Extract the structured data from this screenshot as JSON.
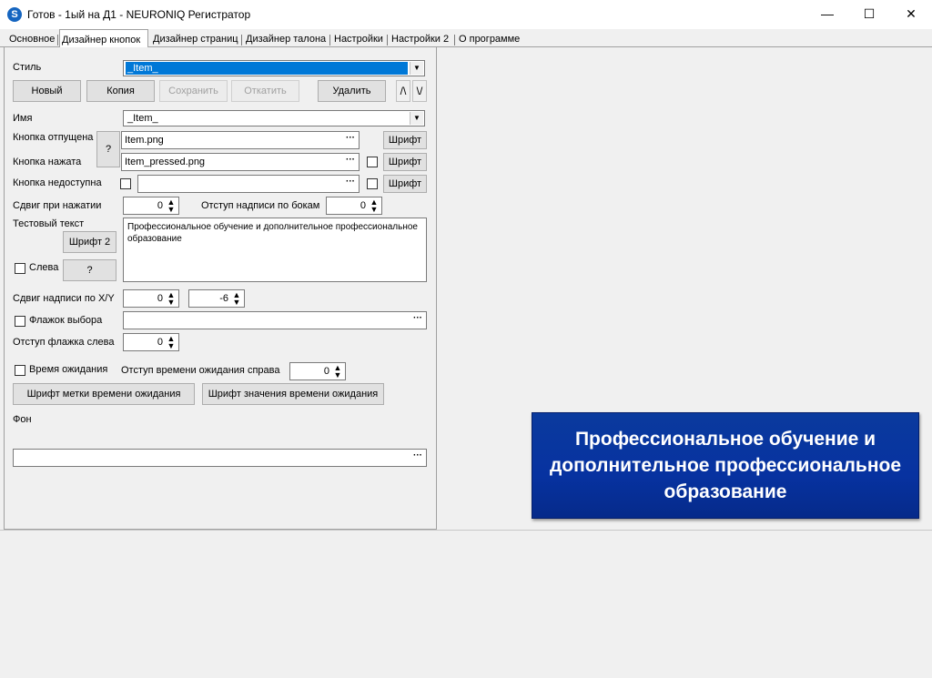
{
  "window": {
    "app_icon": "S",
    "title": "Готов - 1ый на Д1 - NEURONIQ Регистратор",
    "minimize": "—",
    "maximize": "☐",
    "close": "✕"
  },
  "tabs": [
    {
      "label": "Основное",
      "active": false
    },
    {
      "label": "Дизайнер кнопок",
      "active": true
    },
    {
      "label": "Дизайнер страниц",
      "active": false
    },
    {
      "label": "Дизайнер талона",
      "active": false
    },
    {
      "label": "Настройки",
      "active": false
    },
    {
      "label": "Настройки 2",
      "active": false
    },
    {
      "label": "О программе",
      "active": false
    }
  ],
  "style_row": {
    "label": "Стиль",
    "value": "_Item_"
  },
  "style_buttons": {
    "new": "Новый",
    "copy": "Копия",
    "save": "Сохранить",
    "revert": "Откатить",
    "delete": "Удалить",
    "up": "/\\",
    "down": "\\/"
  },
  "name_row": {
    "label": "Имя",
    "value": "_Item_"
  },
  "button_states": {
    "help_label": "?",
    "released_label": "Кнопка отпущена",
    "released_value": "Item.png",
    "pressed_label": "Кнопка нажата",
    "pressed_value": "Item_pressed.png",
    "disabled_label": "Кнопка недоступна",
    "disabled_value": "",
    "browse": "···",
    "font_label": "Шрифт"
  },
  "offsets": {
    "press_shift_label": "Сдвиг при нажатии",
    "press_shift_value": "0",
    "side_padding_label": "Отступ надписи по бокам",
    "side_padding_value": "0"
  },
  "test_text": {
    "label": "Тестовый текст",
    "font2": "Шрифт 2",
    "left_label": "Слева",
    "help": "?",
    "value": "Профессиональное обучение и дополнительное профессиональное образование"
  },
  "caption_shift": {
    "label": "Сдвиг надписи по X/Y",
    "x": "0",
    "y": "-6"
  },
  "checkbox_flag": {
    "label": "Флажок выбора",
    "value": ""
  },
  "flag_offset": {
    "label": "Отступ флажка слева",
    "value": "0"
  },
  "wait_time": {
    "label": "Время ожидания",
    "right_offset_label": "Отступ времени ожидания справа",
    "right_offset_value": "0",
    "label_font_button": "Шрифт метки времени ожидания",
    "value_font_button": "Шрифт значения времени ожидания"
  },
  "background": {
    "label": "Фон",
    "value": ""
  },
  "preview": {
    "text": "Профессиональное обучение и дополнительное профессиональное образование",
    "color": "#0732a0"
  }
}
